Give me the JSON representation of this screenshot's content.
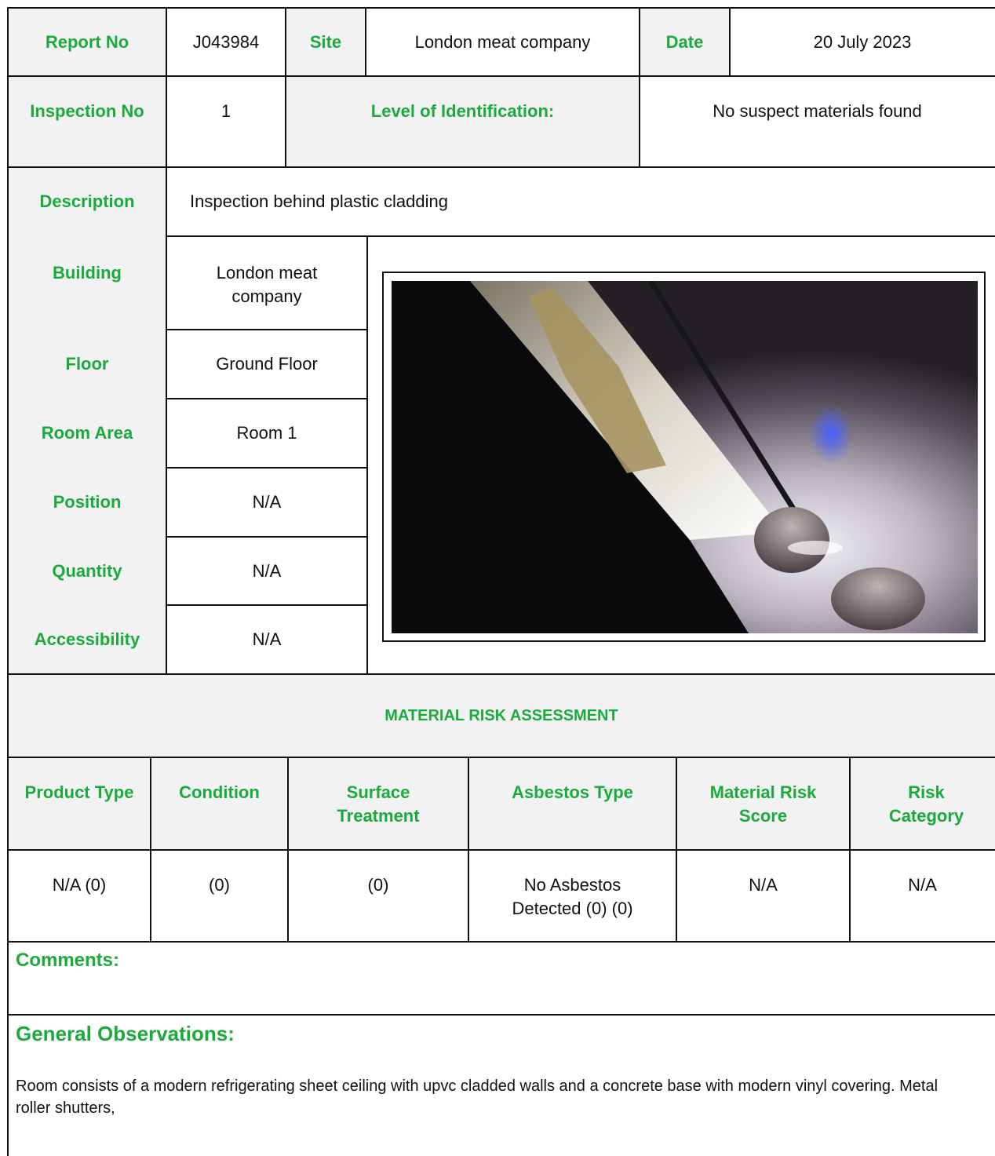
{
  "header": {
    "report_no_label": "Report No",
    "report_no": "J043984",
    "site_label": "Site",
    "site": "London meat company",
    "date_label": "Date",
    "date": "20 July 2023"
  },
  "inspection": {
    "inspection_no_label": "Inspection No",
    "inspection_no": "1",
    "level_label": "Level of Identification:",
    "level": "No suspect materials found"
  },
  "description": {
    "label": "Description",
    "value": "Inspection behind plastic cladding"
  },
  "details": [
    {
      "label": "Building",
      "value": "London meat company"
    },
    {
      "label": "Floor",
      "value": "Ground Floor"
    },
    {
      "label": "Room Area",
      "value": "Room 1"
    },
    {
      "label": "Position",
      "value": "N/A"
    },
    {
      "label": "Quantity",
      "value": "N/A"
    },
    {
      "label": "Accessibility",
      "value": "N/A"
    }
  ],
  "mra": {
    "title": "MATERIAL RISK ASSESSMENT",
    "headers": [
      "Product Type",
      "Condition",
      "Surface Treatment",
      "Asbestos Type",
      "Material Risk Score",
      "Risk Category"
    ],
    "values": [
      "N/A (0)",
      "(0)",
      "(0)",
      "No Asbestos Detected (0) (0)",
      "N/A",
      "N/A"
    ]
  },
  "comments": {
    "label": "Comments:",
    "text": ""
  },
  "observations": {
    "label": "General Observations:",
    "text": "Room consists of a modern refrigerating sheet ceiling with upvc cladded walls and a concrete base with modern vinyl covering. Metal roller shutters,"
  }
}
